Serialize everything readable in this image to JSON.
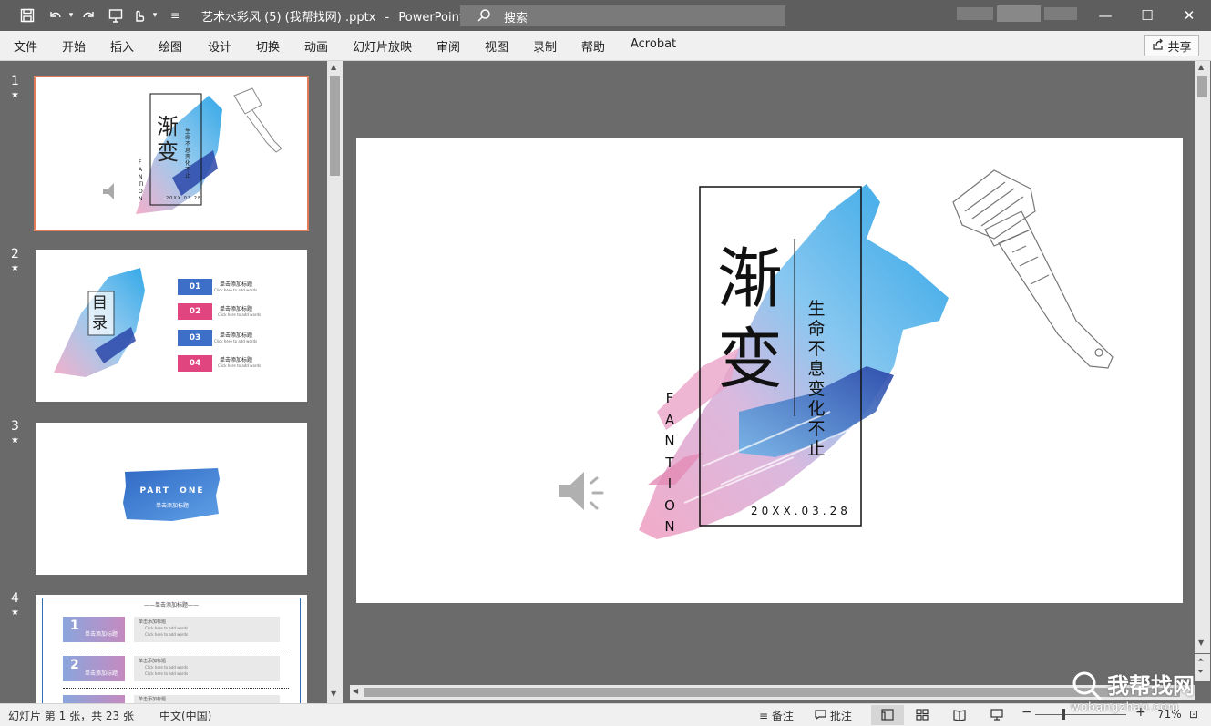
{
  "titlebar": {
    "file_name": "艺术水彩风 (5) (我帮找网) .pptx",
    "separator": "-",
    "app_name": "PowerPoint",
    "search_label": "搜索",
    "minimize": "—",
    "maximize": "☐",
    "close": "✕"
  },
  "ribbon": {
    "tabs": [
      "文件",
      "开始",
      "插入",
      "绘图",
      "设计",
      "切换",
      "动画",
      "幻灯片放映",
      "审阅",
      "视图",
      "录制",
      "帮助",
      "Acrobat"
    ],
    "share_label": "共享"
  },
  "thumbnails": [
    {
      "number": "1",
      "star": "★"
    },
    {
      "number": "2",
      "star": "★"
    },
    {
      "number": "3",
      "star": "★"
    },
    {
      "number": "4",
      "star": "★"
    }
  ],
  "thumb1": {
    "title": "渐变",
    "sub": "生命不息变化不止",
    "letters": "FANTION",
    "date": "20XX.03.28"
  },
  "thumb2": {
    "title": "目录",
    "items": [
      {
        "num": "01",
        "label": "单击添加标题",
        "sub": "Click here to add words",
        "color": "#3d6fc9"
      },
      {
        "num": "02",
        "label": "单击添加标题",
        "sub": "Click here to add words",
        "color": "#e0457f"
      },
      {
        "num": "03",
        "label": "单击添加标题",
        "sub": "Click here to add words",
        "color": "#3d6fc9"
      },
      {
        "num": "04",
        "label": "单击添加标题",
        "sub": "Click here to add words",
        "color": "#e0457f"
      }
    ]
  },
  "thumb3": {
    "title": "PART  ONE",
    "sub": "单击添加标题"
  },
  "thumb4": {
    "header": "——单击添加标题——",
    "rows": [
      {
        "num": "1",
        "label": "单击添加标题",
        "title": "单击添加标题",
        "l1": "Click here to add words",
        "l2": "Click here to add words"
      },
      {
        "num": "2",
        "label": "单击添加标题",
        "title": "单击添加标题",
        "l1": "Click here to add words",
        "l2": "Click here to add words"
      },
      {
        "num": "3",
        "label": "",
        "title": "单击添加标题",
        "l1": "",
        "l2": ""
      }
    ]
  },
  "slide": {
    "title_char1": "渐",
    "title_char2": "变",
    "vertical_text": [
      "生",
      "命",
      "不",
      "息",
      "变",
      "化",
      "不",
      "止"
    ],
    "letters": [
      "F",
      "A",
      "N",
      "T",
      "I",
      "O",
      "N"
    ],
    "date": "20XX.03.28"
  },
  "statusbar": {
    "slide_info": "幻灯片 第 1 张，共 23 张",
    "language": "中文(中国)",
    "notes": "备注",
    "comments": "批注",
    "zoom": "71%"
  },
  "watermark": {
    "text": "我帮找网",
    "url": "wobangzhao.com"
  },
  "colors": {
    "accent": "#e07b5b",
    "brush_blue": "#2fa8e6",
    "brush_pink": "#e889b0",
    "brush_navy": "#2b46a8"
  }
}
